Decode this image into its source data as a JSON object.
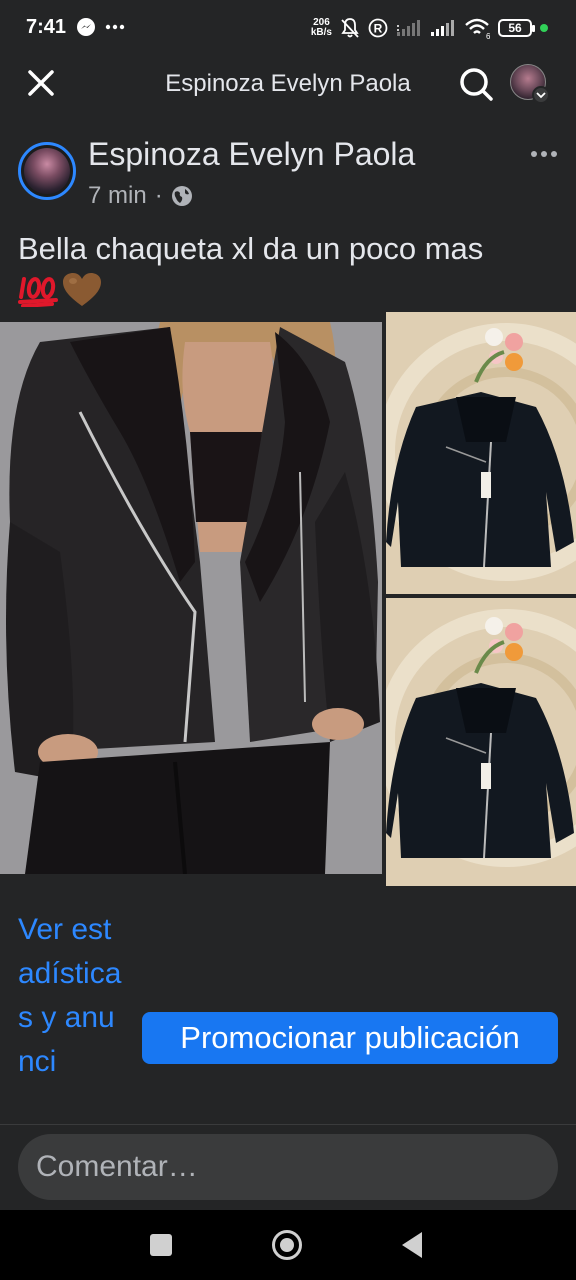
{
  "status_bar": {
    "time": "7:41",
    "net_speed_value": "206",
    "net_speed_unit": "kB/s",
    "battery": "56",
    "icons": [
      "messenger-icon",
      "more-notifications-icon",
      "mute-icon",
      "registered-icon",
      "signal-icon",
      "signal-icon",
      "wifi-icon",
      "battery-icon"
    ]
  },
  "top_bar": {
    "title": "Espinoza Evelyn Paola",
    "icons": [
      "close-icon",
      "search-icon",
      "profile-avatar",
      "chevron-down-icon"
    ]
  },
  "post": {
    "author": "Espinoza Evelyn Paola",
    "time": "7 min",
    "separator": "·",
    "audience_icon": "globe-icon",
    "text": "Bella chaqueta xl da un poco mas",
    "emojis": [
      "hundred-points-emoji",
      "brown-heart-emoji"
    ],
    "photos": [
      {
        "name": "photo-model-wearing-jacket"
      },
      {
        "name": "photo-jacket-flat-1"
      },
      {
        "name": "photo-jacket-flat-2"
      }
    ],
    "stats_link": "Ver estadísticas y anunci",
    "promote_button": "Promocionar publicación"
  },
  "comment": {
    "placeholder": "Comentar…"
  },
  "nav": {
    "icons": [
      "recent-apps-icon",
      "home-icon",
      "back-icon"
    ]
  },
  "colors": {
    "background": "#242526",
    "accent": "#1877f2",
    "link": "#2d88ff",
    "text": "#e4e6eb",
    "muted": "#b0b3b8"
  }
}
